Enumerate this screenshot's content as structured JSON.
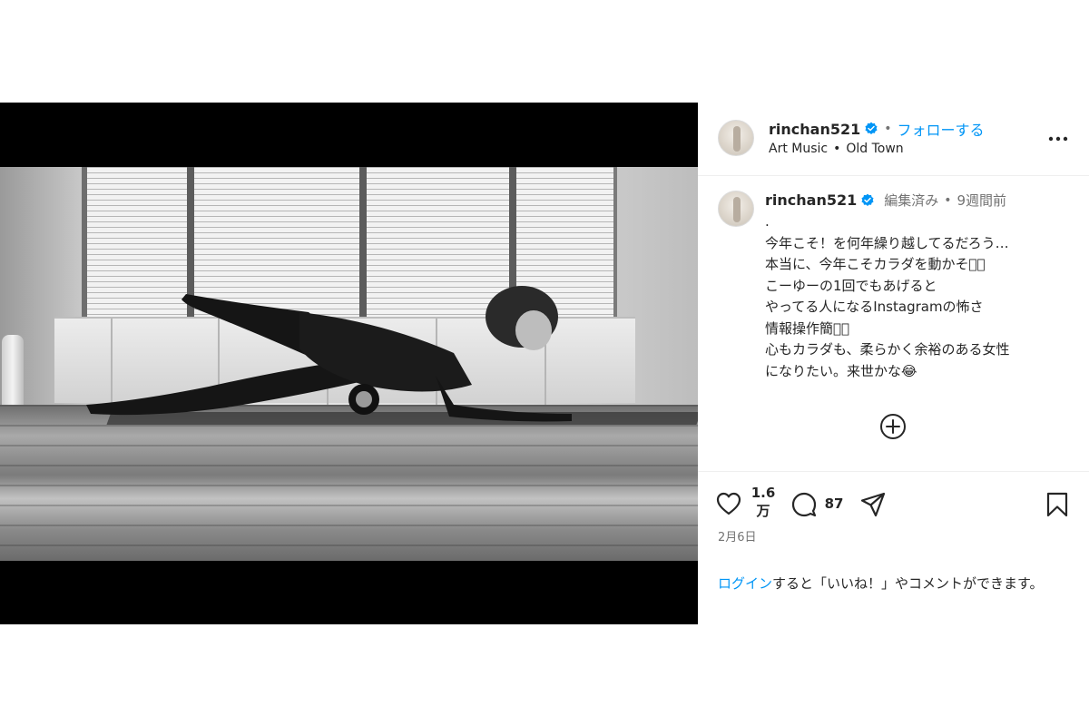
{
  "post": {
    "username": "rinchan521",
    "follow_label": "フォローする",
    "location_music": "Art Music",
    "location_place": "Old Town",
    "separator": "•"
  },
  "caption": {
    "username": "rinchan521",
    "edited_label": "編集済み",
    "separator": "•",
    "time_ago": "9週間前",
    "lines": [
      ".",
      "今年こそ！を何年繰り越してるだろう…",
      "本当に、今年こそカラダを動かそう🏻",
      "こーゆーの1回でもあげると",
      "やってる人になるInstagramの怖さ",
      "情報操作簡単🏻",
      "心もカラダも、柔らかく余裕のある女性",
      "になりたい。来世かな😂"
    ]
  },
  "actions": {
    "likes_line1": "1.6",
    "likes_line2": "万",
    "comments": "87",
    "date": "2月6日"
  },
  "login": {
    "link_label": "ログイン",
    "rest_text": "すると「いいね！」やコメントができます。"
  },
  "colors": {
    "accent": "#0095f6",
    "text": "#262626",
    "secondary": "#737373"
  },
  "icons": {
    "verified": "verified-badge-icon",
    "more": "more-horizontal-icon",
    "mute": "speaker-muted-icon",
    "plus": "plus-circle-icon",
    "like": "heart-icon",
    "comment": "comment-icon",
    "share": "send-icon",
    "save": "bookmark-icon"
  }
}
